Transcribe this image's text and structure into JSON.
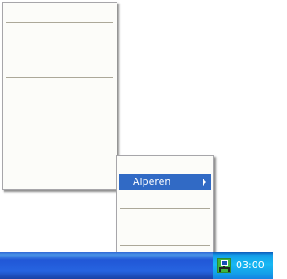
{
  "context_menu": {
    "items": [
      {
        "label": "Alperen",
        "has_submenu": true,
        "highlighted": true
      }
    ]
  },
  "taskbar": {
    "tray": {
      "icon": "network-tray-icon",
      "clock": "03:00"
    }
  },
  "colors": {
    "menu_background": "#fcfcf9",
    "menu_highlight": "#316ac5",
    "taskbar_blue": "#2663e0",
    "tray_blue": "#18b9f3"
  }
}
